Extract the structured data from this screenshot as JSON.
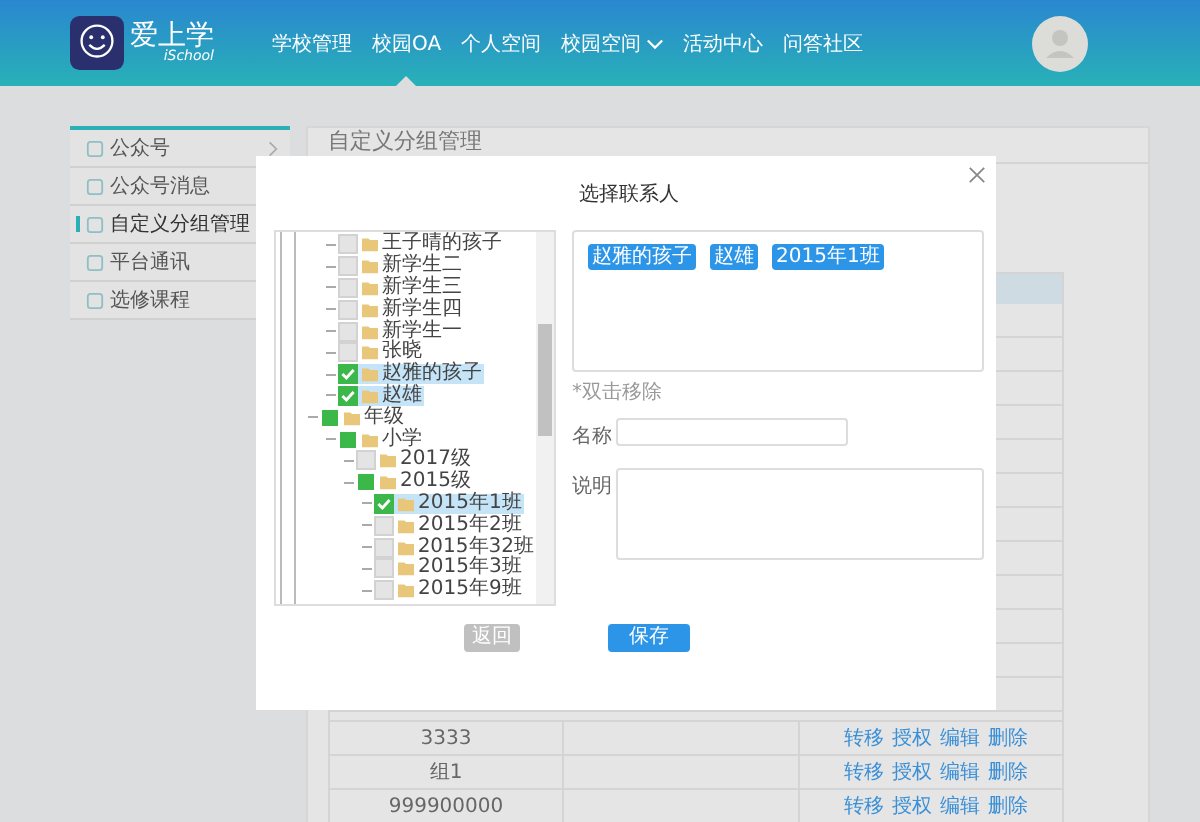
{
  "header": {
    "logo": {
      "title": "爱上学",
      "subtitle": "iSchool"
    },
    "nav": [
      {
        "label": "学校管理",
        "selected": false,
        "dropdown": false
      },
      {
        "label": "校园OA",
        "selected": true,
        "dropdown": false
      },
      {
        "label": "个人空间",
        "selected": false,
        "dropdown": false
      },
      {
        "label": "校园空间",
        "selected": false,
        "dropdown": true
      },
      {
        "label": "活动中心",
        "selected": false,
        "dropdown": false
      },
      {
        "label": "问答社区",
        "selected": false,
        "dropdown": false
      }
    ]
  },
  "sidebar": {
    "items": [
      {
        "label": "公众号",
        "selected": false,
        "arrow": true
      },
      {
        "label": "公众号消息",
        "selected": false
      },
      {
        "label": "自定义分组管理",
        "selected": true
      },
      {
        "label": "平台通讯",
        "selected": false
      },
      {
        "label": "选修课程",
        "selected": false
      }
    ]
  },
  "main": {
    "title": "自定义分组管理",
    "table": {
      "rows": [
        {
          "name": "3333",
          "actions": [
            "转移",
            "授权",
            "编辑",
            "删除"
          ]
        },
        {
          "name": "组1",
          "actions": [
            "转移",
            "授权",
            "编辑",
            "删除"
          ]
        },
        {
          "name": "999900000",
          "actions": [
            "转移",
            "授权",
            "编辑",
            "删除"
          ]
        }
      ]
    }
  },
  "dialog": {
    "title": "选择联系人",
    "tree": [
      {
        "children": [
          {
            "label": "王子晴的孩子",
            "checked": false,
            "partial": false,
            "selected": false
          },
          {
            "label": "新学生二",
            "checked": false,
            "partial": false,
            "selected": false
          },
          {
            "label": "新学生三",
            "checked": false,
            "partial": false,
            "selected": false
          },
          {
            "label": "新学生四",
            "checked": false,
            "partial": false,
            "selected": false
          },
          {
            "label": "新学生一",
            "checked": false,
            "partial": false,
            "selected": false
          },
          {
            "label": "张晓",
            "checked": false,
            "partial": false,
            "selected": false
          },
          {
            "label": "赵雅的孩子",
            "checked": true,
            "selected": true
          },
          {
            "label": "赵雄",
            "checked": true,
            "selected": true
          }
        ]
      },
      {
        "label": "年级",
        "checked": false,
        "partial": true,
        "selected": false,
        "children": [
          {
            "label": "小学",
            "checked": false,
            "partial": true,
            "selected": false,
            "children": [
              {
                "label": "2017级",
                "checked": false,
                "partial": false,
                "selected": false
              },
              {
                "label": "2015级",
                "checked": false,
                "partial": true,
                "selected": false,
                "children": [
                  {
                    "label": "2015年1班",
                    "checked": true,
                    "selected": true
                  },
                  {
                    "label": "2015年2班",
                    "checked": false,
                    "partial": false,
                    "selected": false
                  },
                  {
                    "label": "2015年32班",
                    "checked": false,
                    "partial": false,
                    "selected": false
                  },
                  {
                    "label": "2015年3班",
                    "checked": false,
                    "partial": false,
                    "selected": false
                  },
                  {
                    "label": "2015年9班",
                    "checked": false,
                    "partial": false,
                    "selected": false
                  }
                ]
              }
            ]
          }
        ]
      }
    ],
    "tags": [
      "赵雅的孩子",
      "赵雄",
      "2015年1班"
    ],
    "hint": "*双击移除",
    "name_label": "名称",
    "desc_label": "说明",
    "buttons": [
      {
        "label": "返回",
        "kind": "back"
      },
      {
        "label": "保存",
        "kind": "save"
      }
    ]
  }
}
